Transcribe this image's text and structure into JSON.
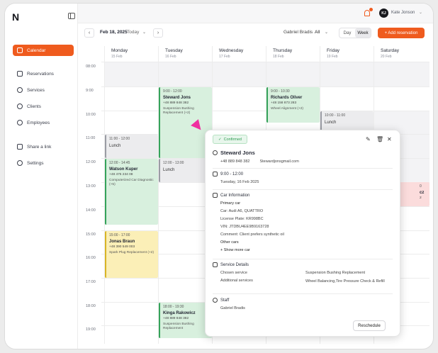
{
  "sidebar": {
    "logo": "N",
    "items": [
      {
        "label": "Calendar",
        "icon": "calendar-icon",
        "active": true
      },
      {
        "label": "Reservations",
        "icon": "reservations-icon"
      },
      {
        "label": "Services",
        "icon": "scissors-icon"
      },
      {
        "label": "Clients",
        "icon": "clients-icon"
      },
      {
        "label": "Employees",
        "icon": "employees-icon"
      },
      {
        "label": "Share a link",
        "icon": "link-icon"
      },
      {
        "label": "Settings",
        "icon": "gear-icon"
      }
    ]
  },
  "topbar": {
    "avatar_initials": "KJ",
    "user_name": "Kate Jonson",
    "accent": "#ef5b1e"
  },
  "toolbar": {
    "prev": "‹",
    "next": "›",
    "date": "Feb 18, 2025",
    "today": "Today",
    "employee_label": "Gabriel Bradis",
    "employee_value": "All",
    "view_day": "Day",
    "view_week": "Week",
    "add_reservation": "+ Add reservation"
  },
  "calendar": {
    "days": [
      {
        "name": "Monday",
        "date": "15 Feb"
      },
      {
        "name": "Tuesday",
        "date": "16 Feb"
      },
      {
        "name": "Wednesday",
        "date": "17 Feb"
      },
      {
        "name": "Thursday",
        "date": "18 Feb"
      },
      {
        "name": "Friday",
        "date": "19 Feb"
      },
      {
        "name": "Saturday",
        "date": "20 Feb"
      }
    ],
    "times": [
      "08:00",
      "9:00",
      "10:00",
      "11:00",
      "12:00",
      "13:00",
      "14:00",
      "15:00",
      "16:00",
      "17:00",
      "18:00",
      "19:00"
    ],
    "events": {
      "tue_steward": {
        "time": "9:00 - 12:00",
        "title": "Steward Jons",
        "phone": "+48 889 848 382",
        "service": "Suspension Bushing Replacement (+2)"
      },
      "thu_richards": {
        "time": "9:00 - 10:30",
        "title": "Richards Oliver",
        "phone": "+48 158 873 283",
        "service": "Wheel Alignment (+2)"
      },
      "fri_lunch": {
        "time": "10:00 - 11:00",
        "title": "Lunch"
      },
      "mon_lunch": {
        "time": "11:00 - 12:00",
        "title": "Lunch"
      },
      "tue_lunch": {
        "time": "12:00 - 13:00",
        "title": "Lunch"
      },
      "mon_watson": {
        "time": "12:00 - 14:45",
        "title": "Watson Kuper",
        "phone": "+48 475 234 08",
        "service": "Computerized Car Diagnostic (+5)"
      },
      "mon_jonas": {
        "time": "15:00 - 17:00",
        "title": "Jonas Braun",
        "phone": "+48 390 549 003",
        "service": "Spark Plug Replacement (+2)"
      },
      "tue_kinga": {
        "time": "18:00 - 19:30",
        "title": "Kinga Rakowicz",
        "phone": "+48 889 848 382",
        "service": "Suspension Bushing Replacement"
      },
      "sat_partial": {
        "line1": "0",
        "line2": "cz",
        "line3": "2"
      }
    }
  },
  "popup": {
    "status": "Confirmed",
    "client_name": "Steward Jons",
    "client_phone": "+48 889 848 382",
    "client_email": "Stewardjonsgmail.com",
    "time_range": "9:00 - 12:00",
    "date": "Tuesday, 16 Feb 2025",
    "car_header": "Car Information",
    "car_primary": "Primary car",
    "car_model": "Car: Audi A6, QUATTRO",
    "license": "License Plate: KR998BC",
    "vin": "VIN: JTDBU4EE9B9163728",
    "comment": "Comment:  Client prefers synthetic oil",
    "other_cars": "Other cars",
    "show_more": "+ Show more car",
    "service_header": "Service Details",
    "chosen_label": "Chosen service",
    "chosen_value": "Suspension Bushing Replacement",
    "additional_label": "Additional services",
    "additional_value": "Wheel Balancing,Tire Pressure Check & Refill",
    "staff_header": "Staff",
    "staff_name": "Gabriel Bradis",
    "reschedule": "Reschedule"
  }
}
